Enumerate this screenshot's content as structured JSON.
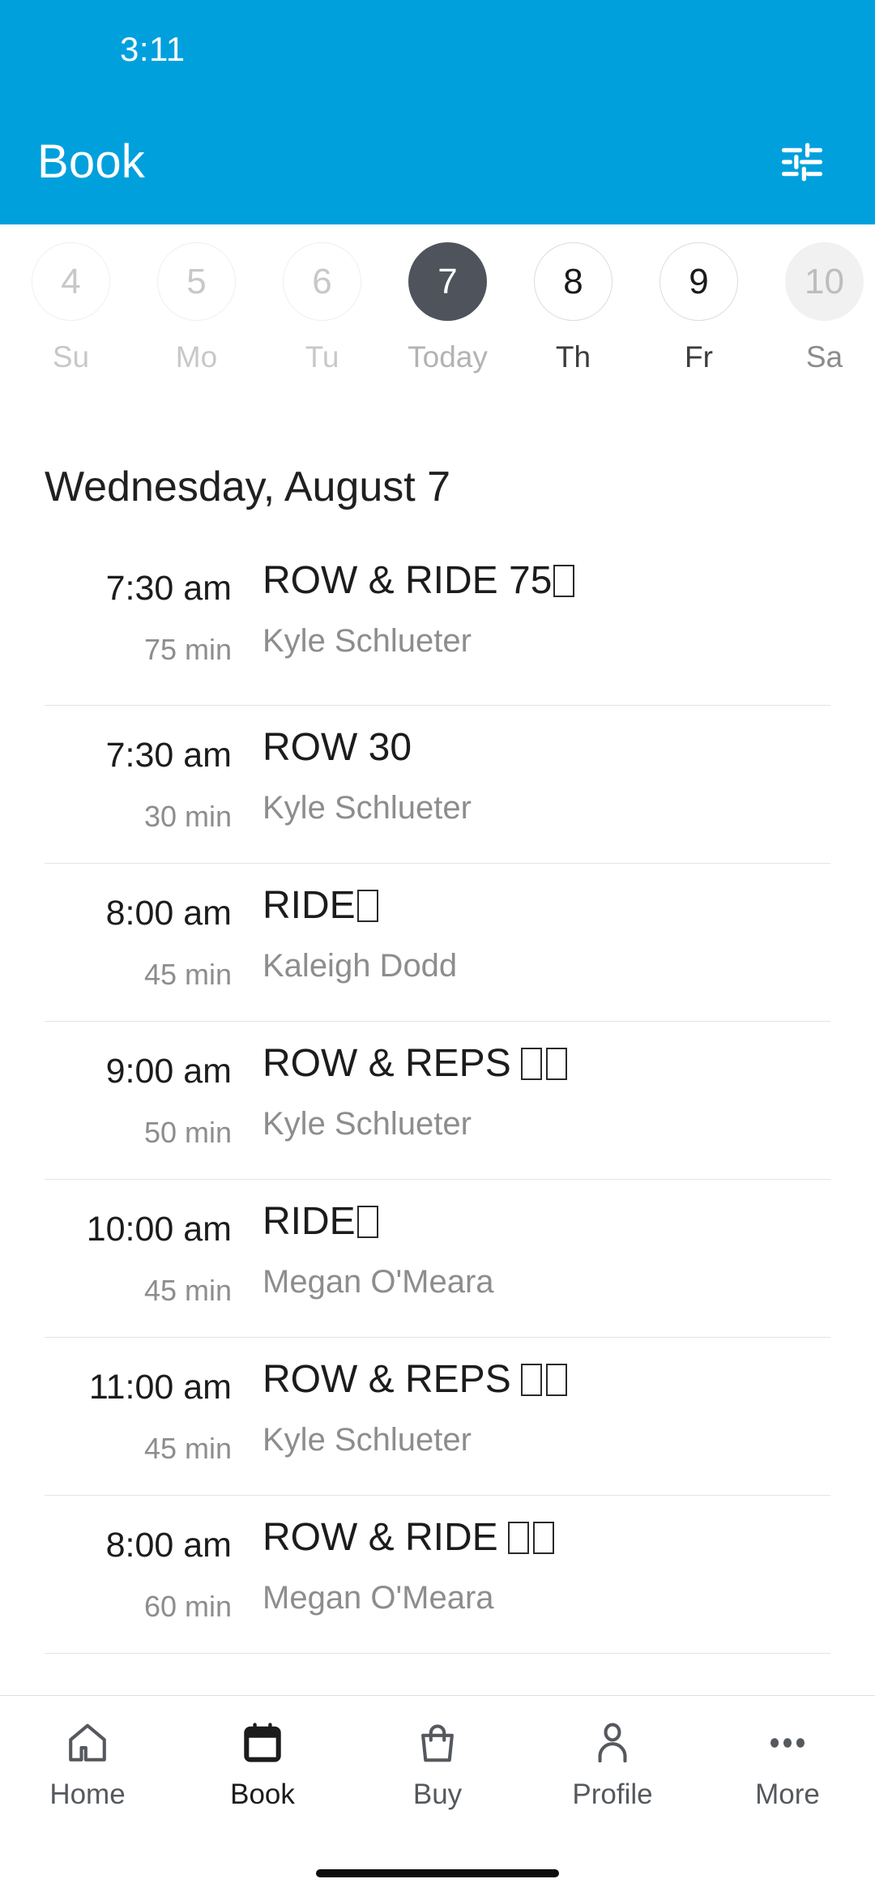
{
  "status_bar": {
    "time": "3:11"
  },
  "app_bar": {
    "title": "Book",
    "filter_icon": "tune-filter-icon",
    "background_color": "#00a0dd",
    "text_color": "#ffffff"
  },
  "date_strip": {
    "selected_color": "#4f535c",
    "days": [
      {
        "number": "4",
        "label": "Su",
        "state": "past"
      },
      {
        "number": "5",
        "label": "Mo",
        "state": "past"
      },
      {
        "number": "6",
        "label": "Tu",
        "state": "past"
      },
      {
        "number": "7",
        "label": "Today",
        "state": "selected"
      },
      {
        "number": "8",
        "label": "Th",
        "state": "future"
      },
      {
        "number": "9",
        "label": "Fr",
        "state": "future"
      },
      {
        "number": "10",
        "label": "Sa",
        "state": "faded"
      }
    ]
  },
  "day_heading": "Wednesday, August 7",
  "classes": [
    {
      "time": "7:30 am",
      "duration": "75 min",
      "name": "ROW & RIDE 75",
      "tofu": 1,
      "tofu_gap": false,
      "instructor": "Kyle Schlueter"
    },
    {
      "time": "7:30 am",
      "duration": "30 min",
      "name": "ROW 30",
      "tofu": 0,
      "tofu_gap": false,
      "instructor": "Kyle Schlueter"
    },
    {
      "time": "8:00 am",
      "duration": "45 min",
      "name": "RIDE",
      "tofu": 1,
      "tofu_gap": false,
      "instructor": "Kaleigh Dodd"
    },
    {
      "time": "9:00 am",
      "duration": "50 min",
      "name": "ROW & REPS",
      "tofu": 2,
      "tofu_gap": true,
      "instructor": "Kyle Schlueter"
    },
    {
      "time": "10:00 am",
      "duration": "45 min",
      "name": "RIDE",
      "tofu": 1,
      "tofu_gap": false,
      "instructor": "Megan O'Meara"
    },
    {
      "time": "11:00 am",
      "duration": "45 min",
      "name": "ROW & REPS",
      "tofu": 2,
      "tofu_gap": true,
      "instructor": "Kyle Schlueter"
    },
    {
      "time": "8:00 am",
      "duration": "60 min",
      "name": "ROW & RIDE",
      "tofu": 2,
      "tofu_gap": true,
      "instructor": "Megan O'Meara"
    }
  ],
  "bottom_nav": {
    "active": "Book",
    "items": [
      {
        "label": "Home",
        "icon": "home-icon"
      },
      {
        "label": "Book",
        "icon": "calendar-icon"
      },
      {
        "label": "Buy",
        "icon": "bag-icon"
      },
      {
        "label": "Profile",
        "icon": "person-icon"
      },
      {
        "label": "More",
        "icon": "ellipsis-icon"
      }
    ]
  }
}
